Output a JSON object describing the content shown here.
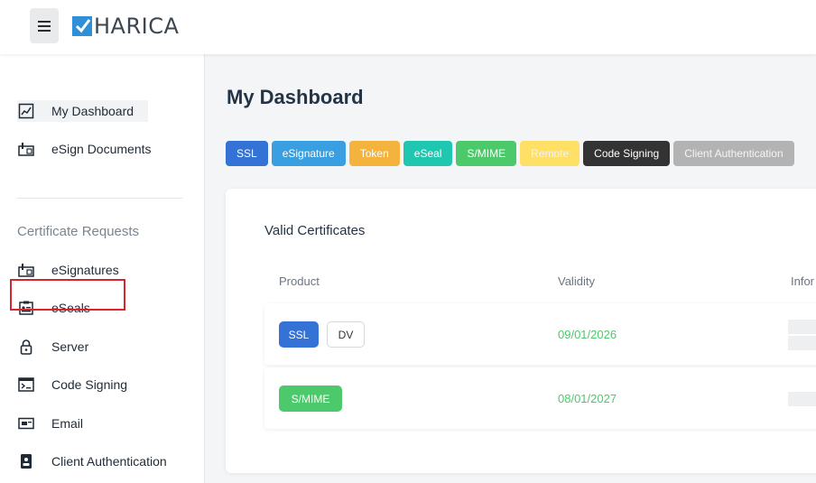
{
  "header": {
    "logo_text": "HARICA",
    "menu_icon": "hamburger-icon",
    "logo_color": "#2f8fd8"
  },
  "sidebar": {
    "top_items": [
      {
        "label": "My Dashboard",
        "icon": "dashboard-icon"
      },
      {
        "label": "eSign Documents",
        "icon": "esign-icon"
      }
    ],
    "section_title": "Certificate Requests",
    "items": [
      {
        "label": "eSignatures",
        "icon": "esign-icon"
      },
      {
        "label": "eSeals",
        "icon": "id-card-icon"
      },
      {
        "label": "Server",
        "icon": "lock-icon"
      },
      {
        "label": "Code Signing",
        "icon": "terminal-icon"
      },
      {
        "label": "Email",
        "icon": "email-card-icon"
      },
      {
        "label": "Client Authentication",
        "icon": "badge-icon"
      }
    ]
  },
  "main": {
    "title": "My Dashboard",
    "chips": [
      {
        "label": "SSL",
        "color": "#3572d6",
        "text_color": "#ffffff"
      },
      {
        "label": "eSignature",
        "color": "#3a9fe0",
        "text_color": "#ffffff"
      },
      {
        "label": "Token",
        "color": "#f3b33d",
        "text_color": "#ffffff"
      },
      {
        "label": "eSeal",
        "color": "#1fc6b0",
        "text_color": "#ffffff"
      },
      {
        "label": "S/MIME",
        "color": "#4cc96a",
        "text_color": "#ffffff"
      },
      {
        "label": "Remote",
        "color": "#ffe066",
        "text_color": "#f2f2f2"
      },
      {
        "label": "Code Signing",
        "color": "#333333",
        "text_color": "#ffffff"
      },
      {
        "label": "Client Authentication",
        "color": "#b3b3b3",
        "text_color": "#f5f5f5"
      }
    ],
    "card": {
      "title": "Valid Certificates",
      "columns": [
        "Product",
        "Validity",
        "Infor"
      ],
      "rows": [
        {
          "tags": [
            {
              "label": "SSL",
              "type": "filled-blue"
            },
            {
              "label": "DV",
              "type": "outline"
            }
          ],
          "validity": "09/01/2026"
        },
        {
          "tags": [
            {
              "label": "S/MIME",
              "type": "filled-green"
            }
          ],
          "validity": "08/01/2027"
        }
      ]
    }
  }
}
